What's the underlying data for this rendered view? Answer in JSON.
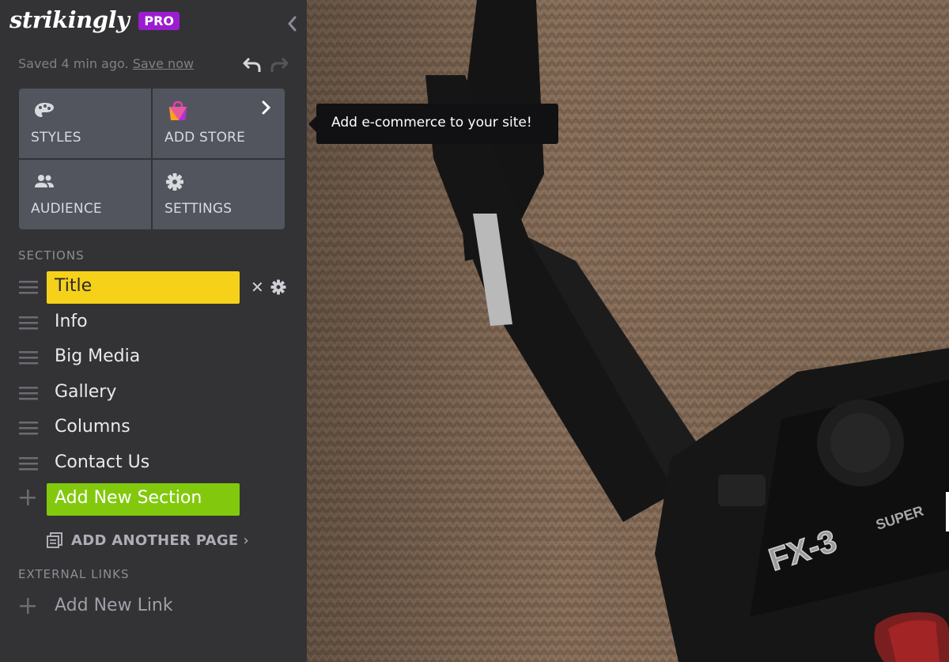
{
  "brand": {
    "logo_text": "strikingly",
    "badge": "PRO"
  },
  "save_status": {
    "text": "Saved 4 min ago.",
    "link": "Save now"
  },
  "tiles": [
    {
      "label": "STYLES",
      "icon": "palette-icon"
    },
    {
      "label": "ADD STORE",
      "icon": "shopping-bag-icon"
    },
    {
      "label": "AUDIENCE",
      "icon": "people-icon"
    },
    {
      "label": "SETTINGS",
      "icon": "gear-icon"
    }
  ],
  "tooltip": {
    "text": "Add e-commerce to your site!"
  },
  "sections": {
    "heading": "SECTIONS",
    "items": [
      {
        "label": "Title",
        "active": true
      },
      {
        "label": "Info"
      },
      {
        "label": "Big Media"
      },
      {
        "label": "Gallery"
      },
      {
        "label": "Columns"
      },
      {
        "label": "Contact Us"
      }
    ],
    "add_label": "Add New Section",
    "add_page_label": "ADD ANOTHER PAGE",
    "add_page_chevron": "›"
  },
  "external_links": {
    "heading": "EXTERNAL LINKS",
    "add_label": "Add New Link"
  },
  "canvas": {
    "camera_model": "FX-3",
    "camera_suffix": "SUPER"
  },
  "colors": {
    "sidebar_bg": "#333336",
    "tile_bg": "#53555e",
    "active_section": "#f6d11a",
    "add_section": "#82c90d",
    "pro_badge": "#9b1dcf",
    "tooltip_bg": "#111113"
  }
}
